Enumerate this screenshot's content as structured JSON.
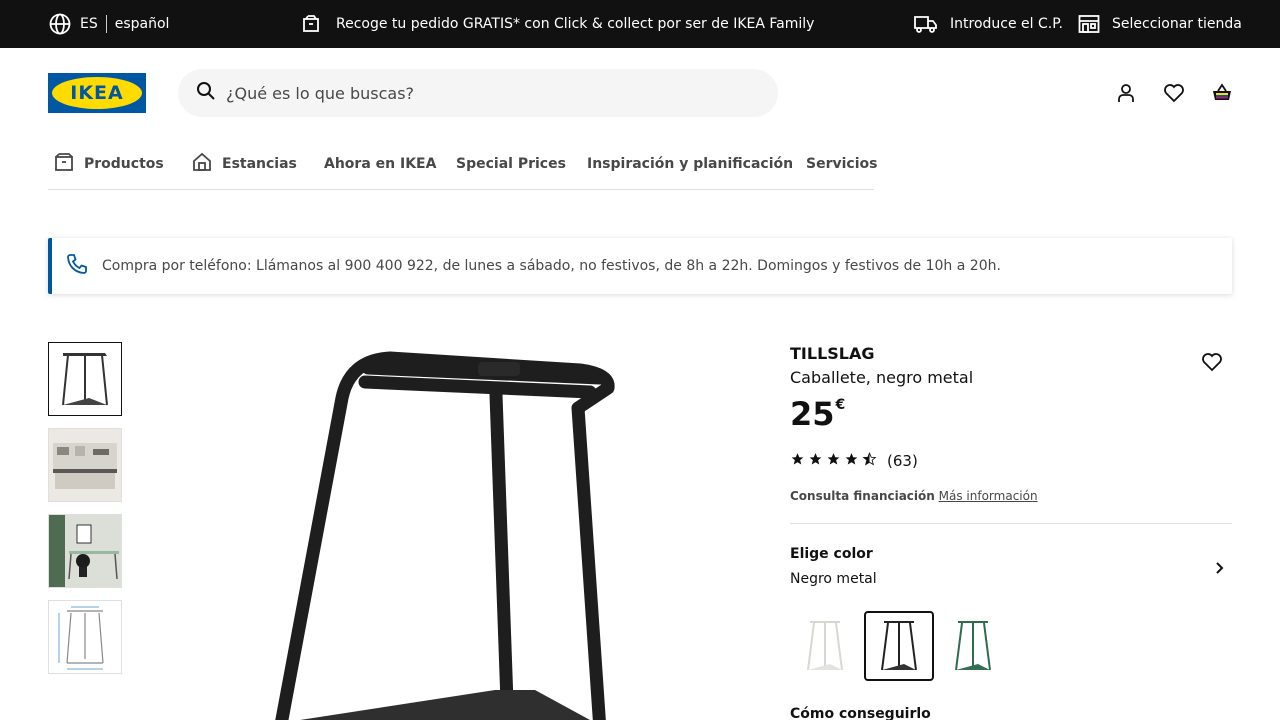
{
  "topbar": {
    "lang_code": "ES",
    "lang_name": "español",
    "promo": "Recoge tu pedido GRATIS* con Click & collect por ser de IKEA Family",
    "postal": "Introduce el C.P.",
    "store": "Seleccionar tienda"
  },
  "header": {
    "logo_text": "IKEA",
    "search_placeholder": "¿Qué es lo que buscas?"
  },
  "nav": {
    "items": [
      {
        "label": "Productos",
        "icon": "box-icon"
      },
      {
        "label": "Estancias",
        "icon": "house-icon"
      },
      {
        "label": "Ahora en IKEA"
      },
      {
        "label": "Special Prices"
      },
      {
        "label": "Inspiración y planificación"
      },
      {
        "label": "Servicios"
      }
    ]
  },
  "banner": {
    "text": "Compra por teléfono: Llámanos al 900 400 922, de lunes a sábado, no festivos, de 8h a 22h. Domingos y festivos de 10h a 20h."
  },
  "product": {
    "name": "TILLSLAG",
    "description": "Caballete, negro metal",
    "price_integer": "25",
    "price_currency": "€",
    "rating": 4.5,
    "rating_count": "(63)",
    "finance_label": "Consulta financiación",
    "finance_link": "Más información",
    "color_label": "Elige color",
    "color_value": "Negro metal",
    "obtain_label": "Cómo conseguirlo"
  },
  "colors": {
    "brand_blue": "#0058a3",
    "brand_yellow": "#ffdb00",
    "swatch_white": "#e8e8e4",
    "swatch_black": "#222222",
    "swatch_green": "#2e6b4f"
  }
}
